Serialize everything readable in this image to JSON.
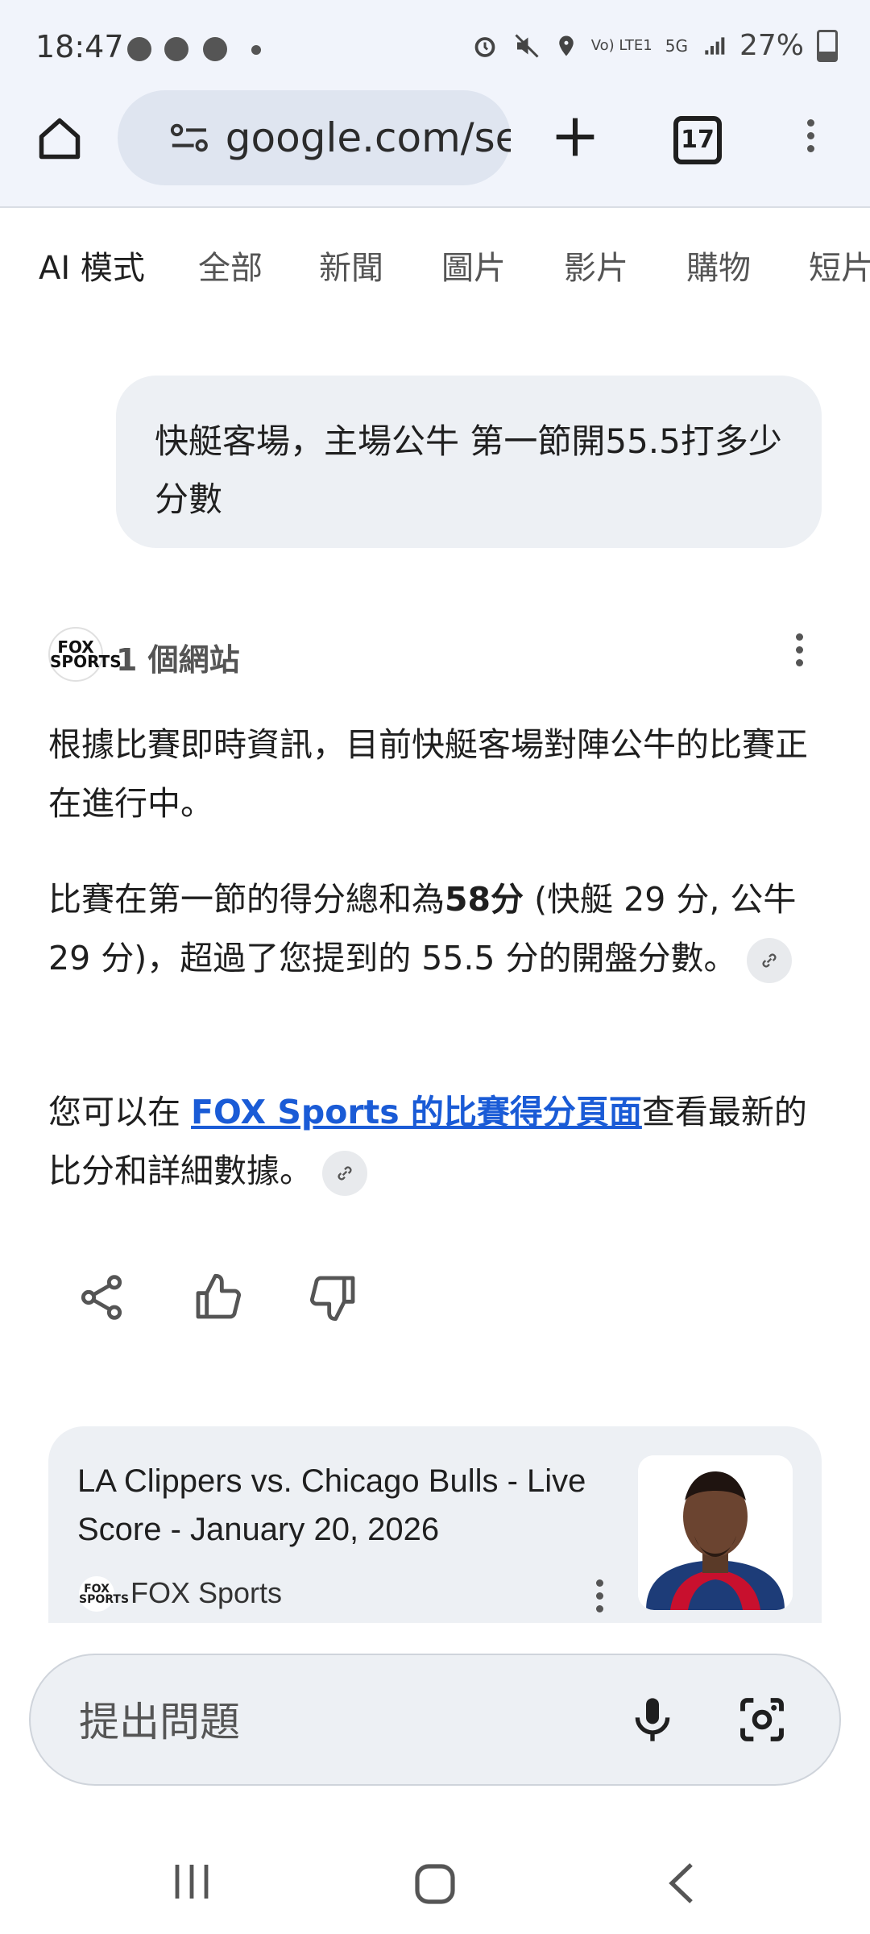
{
  "status_bar": {
    "time": "18:47",
    "network": "5G",
    "carrier": "Vo) LTE1",
    "battery": "27%"
  },
  "browser": {
    "url": "google.com/search",
    "tab_count": "17",
    "icons": [
      "home-icon",
      "site-settings-icon",
      "new-tab-icon",
      "tab-switcher-icon",
      "more-menu-icon"
    ]
  },
  "search_tabs": [
    "AI 模式",
    "全部",
    "新聞",
    "圖片",
    "影片",
    "購物",
    "短片"
  ],
  "query": "快艇客場，主場公牛 第一節開55.5打多少分數",
  "sources": {
    "logo": "FOX SPORTS",
    "count_label": "1 個網站"
  },
  "answer": {
    "p1": "根據比賽即時資訊，目前快艇客場對陣公牛的比賽正在進行中。",
    "p2_before": "比賽在第一節的得分總和為",
    "p2_bold": "58分",
    "p2_after": " (快艇 29 分, 公牛 29 分)，超過了您提到的 55.5 分的開盤分數。",
    "p3_before": "您可以在 ",
    "p3_link": "FOX Sports 的比賽得分頁面",
    "p3_after": "查看最新的比分和詳細數據。"
  },
  "feedback_icons": [
    "share-icon",
    "thumbs-up-icon",
    "thumbs-down-icon"
  ],
  "card": {
    "title": "LA Clippers vs. Chicago Bulls - Live Score - January 20, 2026",
    "source": "FOX Sports",
    "logo": "FOX SPORTS"
  },
  "prompt": {
    "placeholder": "提出問題"
  },
  "colors": {
    "link": "#1a5bd6",
    "bubble": "#edf0f4",
    "chrome": "#f1f4fb"
  }
}
